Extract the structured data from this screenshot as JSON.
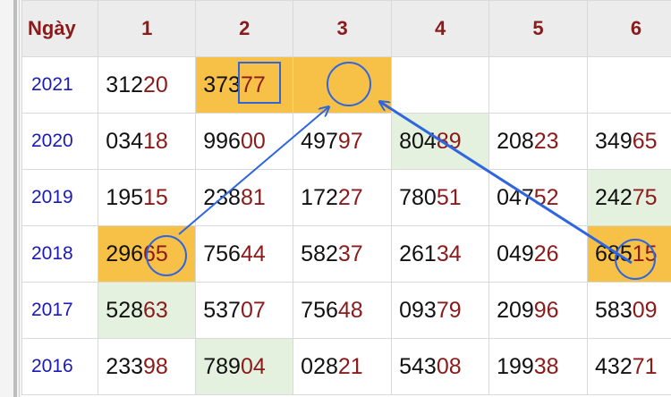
{
  "header": {
    "corner_label": "Ngày",
    "columns": [
      "1",
      "2",
      "3",
      "4",
      "5",
      "6"
    ]
  },
  "rows": [
    {
      "year": "2021",
      "cells": [
        {
          "a": "312",
          "b": "20",
          "hl": ""
        },
        {
          "a": "373",
          "b": "77",
          "hl": "orange"
        },
        {
          "a": "",
          "b": "",
          "hl": "orange"
        },
        {
          "a": "",
          "b": "",
          "hl": ""
        },
        {
          "a": "",
          "b": "",
          "hl": ""
        },
        {
          "a": "",
          "b": "",
          "hl": ""
        }
      ]
    },
    {
      "year": "2020",
      "cells": [
        {
          "a": "034",
          "b": "18",
          "hl": ""
        },
        {
          "a": "996",
          "b": "00",
          "hl": ""
        },
        {
          "a": "497",
          "b": "97",
          "hl": ""
        },
        {
          "a": "804",
          "b": "89",
          "hl": "green"
        },
        {
          "a": "208",
          "b": "23",
          "hl": ""
        },
        {
          "a": "349",
          "b": "65",
          "hl": ""
        }
      ]
    },
    {
      "year": "2019",
      "cells": [
        {
          "a": "195",
          "b": "15",
          "hl": ""
        },
        {
          "a": "238",
          "b": "81",
          "hl": ""
        },
        {
          "a": "172",
          "b": "27",
          "hl": ""
        },
        {
          "a": "780",
          "b": "51",
          "hl": ""
        },
        {
          "a": "047",
          "b": "52",
          "hl": ""
        },
        {
          "a": "242",
          "b": "75",
          "hl": "green"
        }
      ]
    },
    {
      "year": "2018",
      "cells": [
        {
          "a": "296",
          "b": "65",
          "hl": "orange"
        },
        {
          "a": "756",
          "b": "44",
          "hl": ""
        },
        {
          "a": "582",
          "b": "37",
          "hl": ""
        },
        {
          "a": "261",
          "b": "34",
          "hl": ""
        },
        {
          "a": "049",
          "b": "26",
          "hl": ""
        },
        {
          "a": "685",
          "b": "15",
          "hl": "orange"
        }
      ]
    },
    {
      "year": "2017",
      "cells": [
        {
          "a": "528",
          "b": "63",
          "hl": "green"
        },
        {
          "a": "537",
          "b": "07",
          "hl": ""
        },
        {
          "a": "756",
          "b": "48",
          "hl": ""
        },
        {
          "a": "093",
          "b": "79",
          "hl": ""
        },
        {
          "a": "209",
          "b": "96",
          "hl": ""
        },
        {
          "a": "583",
          "b": "09",
          "hl": ""
        }
      ]
    },
    {
      "year": "2016",
      "cells": [
        {
          "a": "233",
          "b": "98",
          "hl": ""
        },
        {
          "a": "789",
          "b": "04",
          "hl": "green"
        },
        {
          "a": "028",
          "b": "21",
          "hl": ""
        },
        {
          "a": "543",
          "b": "08",
          "hl": ""
        },
        {
          "a": "199",
          "b": "38",
          "hl": ""
        },
        {
          "a": "432",
          "b": "71",
          "hl": ""
        }
      ]
    }
  ],
  "colors": {
    "highlight_orange": "#f7c046",
    "highlight_green": "#e4f1de",
    "annotation_blue": "#2f66e0",
    "year_text": "#1a1ab4",
    "header_text": "#8b1a1a",
    "last_digits_text": "#8b1a1a"
  },
  "annotations": {
    "circles": [
      "2018-col1",
      "2018-col6",
      "2021-col3"
    ],
    "square": "2021-col2",
    "arrows": [
      "2018-col1 to 2021-col3",
      "2018-col6 to 2021-col3"
    ]
  }
}
